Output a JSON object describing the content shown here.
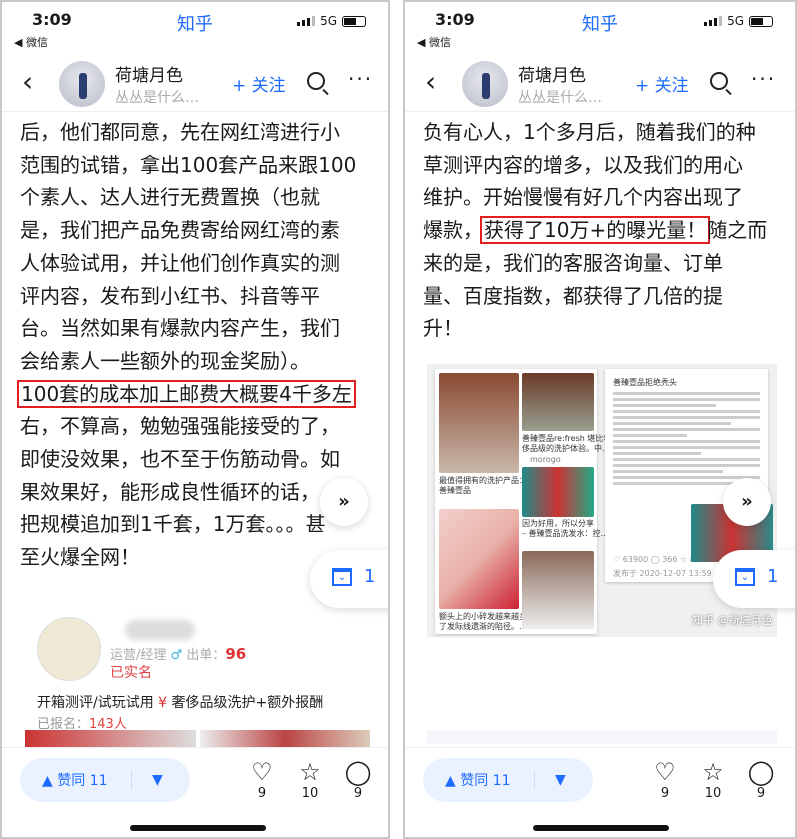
{
  "status": {
    "time": "3:09",
    "back_app": "◀ 微信",
    "app_name": "知乎",
    "network": "5G"
  },
  "header": {
    "author": "荷塘月色",
    "subtitle": "丛丛是什么…",
    "follow": "+ 关注"
  },
  "left": {
    "lines": [
      "后，他们都同意，先在网红湾进行小",
      "范围的试错，拿出100套产品来跟100",
      "个素人、达人进行无费置换（也就",
      "是，我们把产品免费寄给网红湾的素",
      "人体验试用，并让他们创作真实的测",
      "评内容，发布到小红书、抖音等平",
      "台。当然如果有爆款内容产生，我们",
      "会给素人一些额外的现金奖励）。"
    ],
    "highlight": "100套的成本加上邮费大概要4千多左",
    "lines_after": [
      "右，不算高，勉勉强强能接受的了，",
      "即使没效果，也不至于伤筋动骨。如",
      "果效果好，能形成良性循环的话，",
      "把规模追加到1千套，1万套。。。甚",
      "至火爆全网！"
    ],
    "card": {
      "role": "运营/经理",
      "gender": "♂",
      "orders_label": "出单：",
      "orders": "96",
      "verified": "已实名",
      "task": "开箱测评/试玩试用",
      "task_symbol": "¥",
      "reward": "奢侈品级洗护+额外报酬",
      "signed_label": "已报名：",
      "signed": "143人"
    }
  },
  "right": {
    "lines": [
      "负有心人，1个多月后，随着我们的种",
      "草测评内容的增多，以及我们的用心",
      "维护。开始慢慢有好几个内容出现了"
    ],
    "line4_pre": "爆款，",
    "highlight": "获得了10万+的曝光量！",
    "line4_post": "随之而",
    "lines_after": [
      "来的是，我们的客服咨询量、订单",
      "量、百度指数，都获得了几倍的提",
      "升！"
    ],
    "image": {
      "caption1": "最值得拥有的洗护产品：",
      "caption1b": "善臻壹品",
      "caption2": "善臻壹品re:fresh 堪比奢",
      "caption2b": "侈品级的洗护体验。中…",
      "user2": "morogo",
      "caption3": "因为好用，所以分享",
      "caption3b": "– 善臻壹品洗发水：控…",
      "caption4": "额头上的小碎发越来越多",
      "caption4b": "了发际线遗渐的陷径。…",
      "doc_title": "善臻壹品拒绝秃头",
      "doc_stats": "♡ 63900   ◯ 366   ☆ 8630",
      "doc_date": "发布于 2020-12-07 13:59",
      "watermark": "知乎 @荷塘月色"
    }
  },
  "floating": {
    "collection_count": "1",
    "scroll_icon": "double-chevron-down"
  },
  "bottom": {
    "vote_up": "▲  赞同 11",
    "vote_down": "▼",
    "like_count": "9",
    "favorite_count": "10",
    "comment_count": "9"
  },
  "colors": {
    "accent": "#1e6bff",
    "highlight_border": "#e02020"
  }
}
